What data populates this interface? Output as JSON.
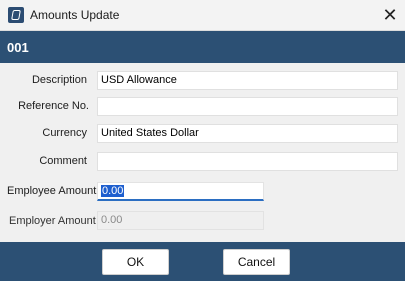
{
  "window": {
    "title": "Amounts Update",
    "close_symbol": "✕",
    "icon": "app-icon"
  },
  "header": {
    "record_id": "001"
  },
  "form": {
    "description": {
      "label": "Description",
      "value": "USD Allowance"
    },
    "reference": {
      "label": "Reference No.",
      "value": ""
    },
    "currency": {
      "label": "Currency",
      "value": "United States Dollar"
    },
    "comment": {
      "label": "Comment",
      "value": ""
    },
    "employee_amount": {
      "label": "Employee Amount",
      "value": "0.00"
    },
    "employer_amount": {
      "label": "Employer Amount",
      "value": "0.00"
    }
  },
  "footer": {
    "ok_label": "OK",
    "cancel_label": "Cancel"
  },
  "colors": {
    "band": "#2c5074",
    "selection": "#1e5fcf"
  }
}
